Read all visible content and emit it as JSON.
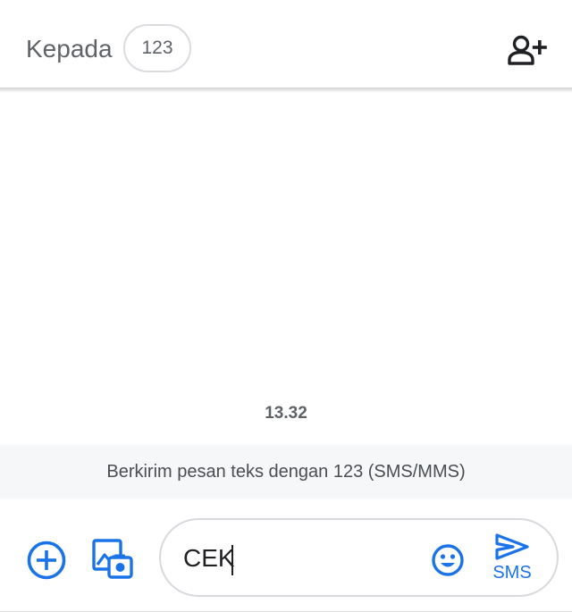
{
  "header": {
    "to_label": "Kepada",
    "recipient": "123",
    "add_contact_icon": "person-add-icon"
  },
  "conversation": {
    "timestamp": "13.32",
    "info_text": "Berkirim pesan teks dengan 123 (SMS/MMS)"
  },
  "compose": {
    "attach_icon": "plus-circle-icon",
    "gallery_icon": "gallery-camera-icon",
    "message_value": "CEK",
    "emoji_icon": "emoji-icon",
    "send_icon": "send-icon",
    "send_label": "SMS"
  },
  "colors": {
    "accent": "#1a73e8",
    "text_secondary": "#5f6368",
    "info_bg": "#f6f7f8"
  }
}
